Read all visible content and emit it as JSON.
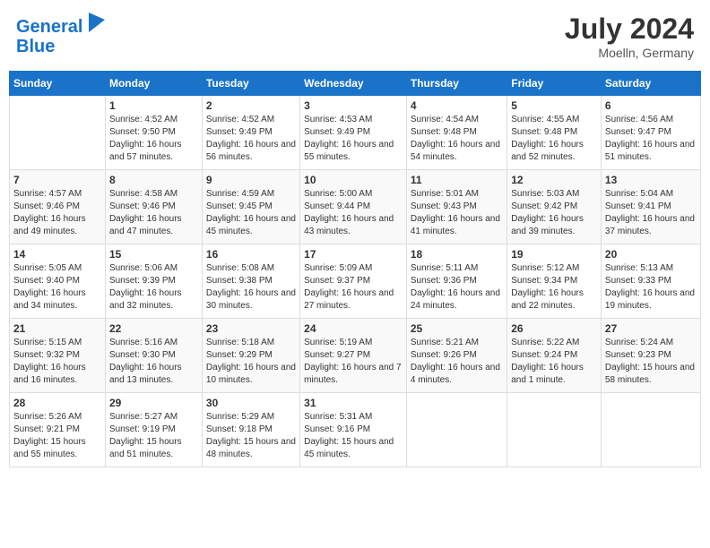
{
  "header": {
    "logo_line1": "General",
    "logo_line2": "Blue",
    "title": "July 2024",
    "location": "Moelln, Germany"
  },
  "columns": [
    "Sunday",
    "Monday",
    "Tuesday",
    "Wednesday",
    "Thursday",
    "Friday",
    "Saturday"
  ],
  "weeks": [
    [
      {
        "day": "",
        "info": ""
      },
      {
        "day": "1",
        "info": "Sunrise: 4:52 AM\nSunset: 9:50 PM\nDaylight: 16 hours and 57 minutes."
      },
      {
        "day": "2",
        "info": "Sunrise: 4:52 AM\nSunset: 9:49 PM\nDaylight: 16 hours and 56 minutes."
      },
      {
        "day": "3",
        "info": "Sunrise: 4:53 AM\nSunset: 9:49 PM\nDaylight: 16 hours and 55 minutes."
      },
      {
        "day": "4",
        "info": "Sunrise: 4:54 AM\nSunset: 9:48 PM\nDaylight: 16 hours and 54 minutes."
      },
      {
        "day": "5",
        "info": "Sunrise: 4:55 AM\nSunset: 9:48 PM\nDaylight: 16 hours and 52 minutes."
      },
      {
        "day": "6",
        "info": "Sunrise: 4:56 AM\nSunset: 9:47 PM\nDaylight: 16 hours and 51 minutes."
      }
    ],
    [
      {
        "day": "7",
        "info": "Sunrise: 4:57 AM\nSunset: 9:46 PM\nDaylight: 16 hours and 49 minutes."
      },
      {
        "day": "8",
        "info": "Sunrise: 4:58 AM\nSunset: 9:46 PM\nDaylight: 16 hours and 47 minutes."
      },
      {
        "day": "9",
        "info": "Sunrise: 4:59 AM\nSunset: 9:45 PM\nDaylight: 16 hours and 45 minutes."
      },
      {
        "day": "10",
        "info": "Sunrise: 5:00 AM\nSunset: 9:44 PM\nDaylight: 16 hours and 43 minutes."
      },
      {
        "day": "11",
        "info": "Sunrise: 5:01 AM\nSunset: 9:43 PM\nDaylight: 16 hours and 41 minutes."
      },
      {
        "day": "12",
        "info": "Sunrise: 5:03 AM\nSunset: 9:42 PM\nDaylight: 16 hours and 39 minutes."
      },
      {
        "day": "13",
        "info": "Sunrise: 5:04 AM\nSunset: 9:41 PM\nDaylight: 16 hours and 37 minutes."
      }
    ],
    [
      {
        "day": "14",
        "info": "Sunrise: 5:05 AM\nSunset: 9:40 PM\nDaylight: 16 hours and 34 minutes."
      },
      {
        "day": "15",
        "info": "Sunrise: 5:06 AM\nSunset: 9:39 PM\nDaylight: 16 hours and 32 minutes."
      },
      {
        "day": "16",
        "info": "Sunrise: 5:08 AM\nSunset: 9:38 PM\nDaylight: 16 hours and 30 minutes."
      },
      {
        "day": "17",
        "info": "Sunrise: 5:09 AM\nSunset: 9:37 PM\nDaylight: 16 hours and 27 minutes."
      },
      {
        "day": "18",
        "info": "Sunrise: 5:11 AM\nSunset: 9:36 PM\nDaylight: 16 hours and 24 minutes."
      },
      {
        "day": "19",
        "info": "Sunrise: 5:12 AM\nSunset: 9:34 PM\nDaylight: 16 hours and 22 minutes."
      },
      {
        "day": "20",
        "info": "Sunrise: 5:13 AM\nSunset: 9:33 PM\nDaylight: 16 hours and 19 minutes."
      }
    ],
    [
      {
        "day": "21",
        "info": "Sunrise: 5:15 AM\nSunset: 9:32 PM\nDaylight: 16 hours and 16 minutes."
      },
      {
        "day": "22",
        "info": "Sunrise: 5:16 AM\nSunset: 9:30 PM\nDaylight: 16 hours and 13 minutes."
      },
      {
        "day": "23",
        "info": "Sunrise: 5:18 AM\nSunset: 9:29 PM\nDaylight: 16 hours and 10 minutes."
      },
      {
        "day": "24",
        "info": "Sunrise: 5:19 AM\nSunset: 9:27 PM\nDaylight: 16 hours and 7 minutes."
      },
      {
        "day": "25",
        "info": "Sunrise: 5:21 AM\nSunset: 9:26 PM\nDaylight: 16 hours and 4 minutes."
      },
      {
        "day": "26",
        "info": "Sunrise: 5:22 AM\nSunset: 9:24 PM\nDaylight: 16 hours and 1 minute."
      },
      {
        "day": "27",
        "info": "Sunrise: 5:24 AM\nSunset: 9:23 PM\nDaylight: 15 hours and 58 minutes."
      }
    ],
    [
      {
        "day": "28",
        "info": "Sunrise: 5:26 AM\nSunset: 9:21 PM\nDaylight: 15 hours and 55 minutes."
      },
      {
        "day": "29",
        "info": "Sunrise: 5:27 AM\nSunset: 9:19 PM\nDaylight: 15 hours and 51 minutes."
      },
      {
        "day": "30",
        "info": "Sunrise: 5:29 AM\nSunset: 9:18 PM\nDaylight: 15 hours and 48 minutes."
      },
      {
        "day": "31",
        "info": "Sunrise: 5:31 AM\nSunset: 9:16 PM\nDaylight: 15 hours and 45 minutes."
      },
      {
        "day": "",
        "info": ""
      },
      {
        "day": "",
        "info": ""
      },
      {
        "day": "",
        "info": ""
      }
    ]
  ]
}
